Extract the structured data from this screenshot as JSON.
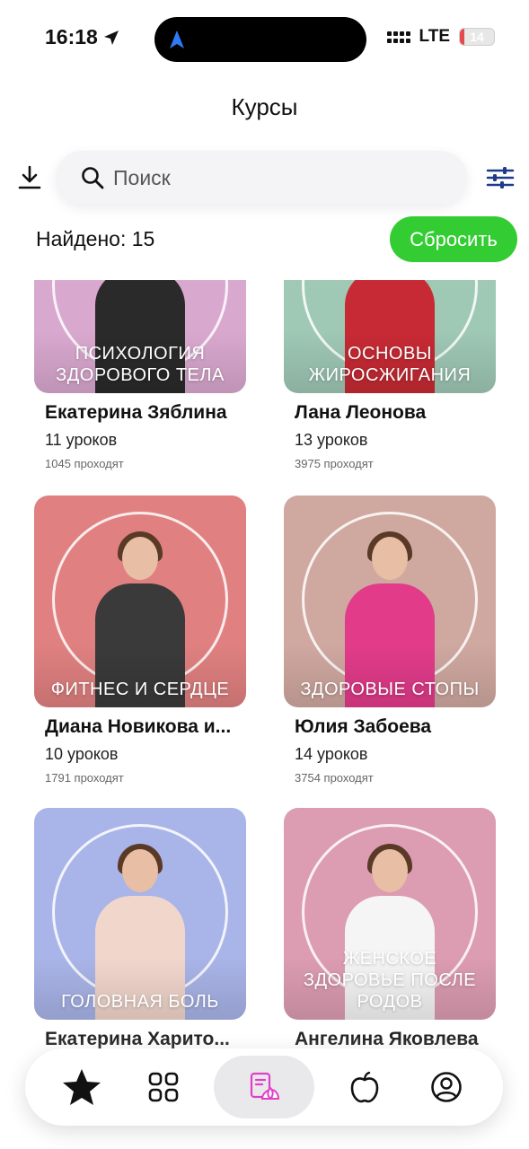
{
  "status_bar": {
    "time": "16:18",
    "network": "LTE",
    "battery": "14",
    "battery_level": 0.14,
    "icons": [
      "location-arrow-icon",
      "signal-icon",
      "battery-icon"
    ]
  },
  "header": {
    "title": "Курсы"
  },
  "search": {
    "placeholder": "Поиск",
    "value": ""
  },
  "results": {
    "found_text": "Найдено: 15",
    "reset_label": "Сбросить"
  },
  "colors": {
    "accent_green": "#33cc33",
    "tab_active_pink": "#e040c8"
  },
  "courses": [
    {
      "cover_title": "ПСИХОЛОГИЯ ЗДОРОВОГО ТЕЛА",
      "author": "Екатерина Зяблина",
      "lessons": "11 уроков",
      "students": "1045 проходят",
      "bg": "#d9a8cf",
      "outfit": "#2a2a2a"
    },
    {
      "cover_title": "ОСНОВЫ ЖИРОСЖИГАНИЯ",
      "author": "Лана Леонова",
      "lessons": "13 уроков",
      "students": "3975 проходят",
      "bg": "#9fc8b5",
      "outfit": "#c72a34"
    },
    {
      "cover_title": "ФИТНЕС И СЕРДЦЕ",
      "author": "Диана Новикова и...",
      "lessons": "10 уроков",
      "students": "1791 проходят",
      "bg": "#e08080",
      "outfit": "#3a3a3a"
    },
    {
      "cover_title": "ЗДОРОВЫЕ СТОПЫ",
      "author": "Юлия Забоева",
      "lessons": "14 уроков",
      "students": "3754 проходят",
      "bg": "#cfa8a0",
      "outfit": "#e23b8a"
    },
    {
      "cover_title": "ГОЛОВНАЯ БОЛЬ",
      "author": "Екатерина Харито...",
      "lessons": "",
      "students": "",
      "bg": "#a9b4e8",
      "outfit": "#f1d6cc"
    },
    {
      "cover_title": "ЖЕНСКОЕ ЗДОРОВЬЕ ПОСЛЕ РОДОВ",
      "author": "Ангелина Яковлева",
      "lessons": "",
      "students": "",
      "bg": "#dc9cb2",
      "outfit": "#f5f5f5"
    }
  ],
  "tab_bar": {
    "tabs": [
      {
        "icon": "star-icon",
        "active": false
      },
      {
        "icon": "grid-icon",
        "active": false
      },
      {
        "icon": "courses-lotus-icon",
        "active": true
      },
      {
        "icon": "apple-icon",
        "active": false
      },
      {
        "icon": "profile-icon",
        "active": false
      }
    ]
  }
}
